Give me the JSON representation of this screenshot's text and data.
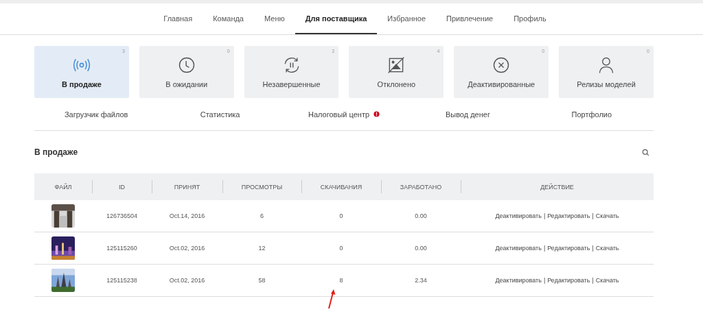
{
  "nav": [
    {
      "label": "Главная",
      "selected": false
    },
    {
      "label": "Команда",
      "selected": false
    },
    {
      "label": "Меню",
      "selected": false
    },
    {
      "label": "Для поставщика",
      "selected": true
    },
    {
      "label": "Избранное",
      "selected": false
    },
    {
      "label": "Привлечение",
      "selected": false
    },
    {
      "label": "Профиль",
      "selected": false
    }
  ],
  "status_cards": [
    {
      "label": "В продаже",
      "count": "3",
      "kind": "broadcast",
      "selected": true
    },
    {
      "label": "В ожидании",
      "count": "0",
      "kind": "clock",
      "selected": false
    },
    {
      "label": "Незавершенные",
      "count": "2",
      "kind": "cycle",
      "selected": false
    },
    {
      "label": "Отклонено",
      "count": "4",
      "kind": "image-off",
      "selected": false
    },
    {
      "label": "Деактивированные",
      "count": "0",
      "kind": "x-circle",
      "selected": false
    },
    {
      "label": "Релизы моделей",
      "count": "0",
      "kind": "person",
      "selected": false
    }
  ],
  "subnav": [
    {
      "label": "Загрузчик файлов",
      "alert": false
    },
    {
      "label": "Статистика",
      "alert": false
    },
    {
      "label": "Налоговый центр",
      "alert": true
    },
    {
      "label": "Вывод денег",
      "alert": false
    },
    {
      "label": "Портфолио",
      "alert": false
    }
  ],
  "section_title": "В продаже",
  "table": {
    "columns": [
      "ФАЙЛ",
      "ID",
      "ПРИНЯТ",
      "ПРОСМОТРЫ",
      "СКАЧИВАНИЯ",
      "ЗАРАБОТАНО",
      "ДЕЙСТВИЕ"
    ],
    "action_separator": "|",
    "rows": [
      {
        "id": "126736504",
        "accepted": "Oct.14, 2016",
        "views": "6",
        "downloads": "0",
        "earned": "0.00",
        "actions": [
          "Деактивировать",
          "Редактировать",
          "Скачать"
        ]
      },
      {
        "id": "125115260",
        "accepted": "Oct.02, 2016",
        "views": "12",
        "downloads": "0",
        "earned": "0.00",
        "actions": [
          "Деактивировать",
          "Редактировать",
          "Скачать"
        ]
      },
      {
        "id": "125115238",
        "accepted": "Oct.02, 2016",
        "views": "58",
        "downloads": "8",
        "earned": "2.34",
        "actions": [
          "Деактивировать",
          "Редактировать",
          "Скачать"
        ]
      }
    ]
  }
}
